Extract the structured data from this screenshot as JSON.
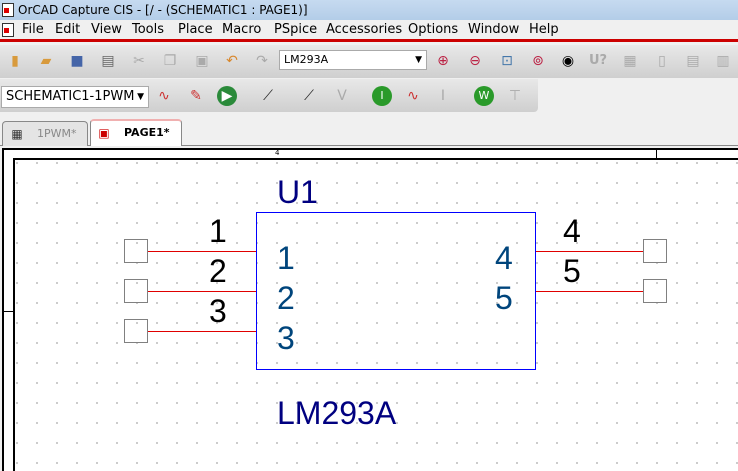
{
  "window": {
    "title": "OrCAD Capture CIS - [/ - (SCHEMATIC1 : PAGE1)]"
  },
  "menu": [
    "File",
    "Edit",
    "View",
    "Tools",
    "Place",
    "Macro",
    "PSpice",
    "Accessories",
    "Options",
    "Window",
    "Help"
  ],
  "toolbar": {
    "part_combo": "LM293A",
    "schematic_combo": "SCHEMATIC1-1PWM"
  },
  "tabs": [
    {
      "label": "1PWM*",
      "active": false
    },
    {
      "label": "PAGE1*",
      "active": true
    }
  ],
  "ruler": {
    "mark": "4"
  },
  "part": {
    "ref": "U1",
    "value": "LM293A",
    "left_pins": [
      {
        "ext": "1",
        "int": "1"
      },
      {
        "ext": "2",
        "int": "2"
      },
      {
        "ext": "3",
        "int": "3"
      }
    ],
    "right_pins": [
      {
        "ext": "4",
        "int": "4"
      },
      {
        "ext": "5",
        "int": "5"
      }
    ]
  },
  "colors": {
    "body": "#0000ff",
    "text": "#000080",
    "pin_number": "#00457c",
    "wire": "#e00000",
    "menu_rule": "#cc0000"
  }
}
